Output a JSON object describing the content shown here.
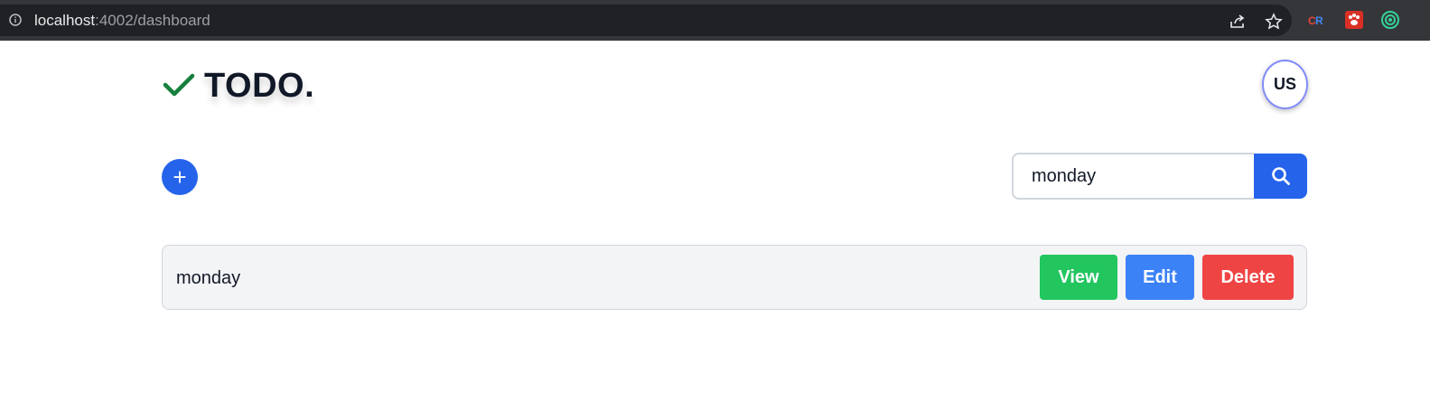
{
  "browser": {
    "url_host": "localhost",
    "url_path": ":4002/dashboard",
    "icons": [
      "info-icon",
      "share-icon",
      "bookmark-star-icon",
      "extension-icons"
    ]
  },
  "app": {
    "logo_text": "TODO.",
    "avatar_initials": "US",
    "add_label": "+",
    "search": {
      "value": "monday"
    },
    "todos": [
      {
        "title": "monday",
        "actions": [
          "View",
          "Edit",
          "Delete"
        ]
      }
    ]
  },
  "colors": {
    "primary": "#2563eb",
    "view": "#22c55e",
    "edit": "#3b82f6",
    "delete": "#ef4444",
    "check": "#15803d"
  }
}
